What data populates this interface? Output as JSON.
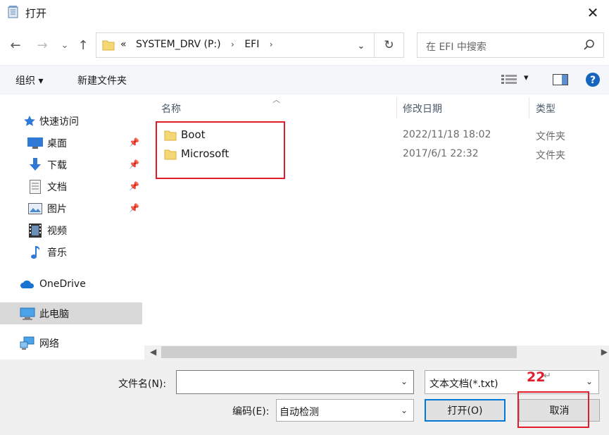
{
  "window": {
    "title": "打开",
    "close": "✕"
  },
  "nav": {
    "back": "←",
    "forward": "→",
    "recent": "⌄",
    "up": "↑",
    "address": {
      "prefix": "«",
      "crumbs": [
        "SYSTEM_DRV (P:)",
        "EFI"
      ],
      "sep": "›",
      "dropdown": "⌄",
      "refresh": "↻"
    },
    "search_placeholder": "在 EFI 中搜索"
  },
  "toolbar": {
    "organize": "组织 ▾",
    "new_folder": "新建文件夹",
    "view_dropdown": "▾"
  },
  "sidebar": {
    "quick_access": "快速访问",
    "quick_items": [
      {
        "label": "桌面",
        "icon": "desktop-icon"
      },
      {
        "label": "下载",
        "icon": "download-icon"
      },
      {
        "label": "文档",
        "icon": "document-icon"
      },
      {
        "label": "图片",
        "icon": "pictures-icon"
      },
      {
        "label": "视频",
        "icon": "video-icon"
      },
      {
        "label": "音乐",
        "icon": "music-icon"
      }
    ],
    "onedrive": "OneDrive",
    "this_pc": "此电脑",
    "network": "网络"
  },
  "columns": {
    "name": "名称",
    "date": "修改日期",
    "type": "类型"
  },
  "files": [
    {
      "name": "Boot",
      "date": "2022/11/18 18:02",
      "type": "文件夹"
    },
    {
      "name": "Microsoft",
      "date": "2017/6/1 22:32",
      "type": "文件夹"
    }
  ],
  "footer": {
    "filename_label": "文件名(N):",
    "filename_value": "",
    "filetype_value": "文本文档(*.txt)",
    "encoding_label": "编码(E):",
    "encoding_value": "自动检测",
    "open_button": "打开(O)",
    "cancel_button": "取消",
    "annotation_number": "22",
    "annotation_mark": "↵"
  },
  "colors": {
    "highlight": "#e21c2a",
    "accent": "#0078d7"
  }
}
